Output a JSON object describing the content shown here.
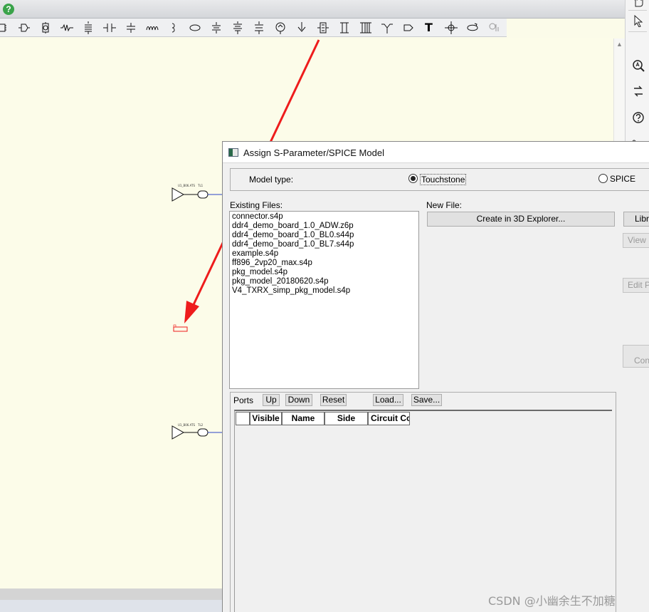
{
  "dialog": {
    "title": "Assign S-Parameter/SPICE Model",
    "model_type_label": "Model type:",
    "touchstone_label": "Touchstone",
    "spice_label": "SPICE",
    "existing_files_label": "Existing Files:",
    "new_file_label": "New File:",
    "files": [
      "connector.s4p",
      "ddr4_demo_board_1.0_ADW.z6p",
      "ddr4_demo_board_1.0_BL0.s44p",
      "ddr4_demo_board_1.0_BL7.s44p",
      "example.s4p",
      "ff896_2vp20_max.s4p",
      "pkg_model.s4p",
      "pkg_model_20180620.s4p",
      "V4_TXRX_simp_pkg_model.s4p"
    ],
    "create_3d_label": "Create in 3D Explorer...",
    "library_label": "Libra",
    "view_label": "View N",
    "edit_label": "Edit Pa",
    "conn_label": "Conn",
    "ports_label": "Ports",
    "up_label": "Up",
    "down_label": "Down",
    "reset_label": "Reset",
    "load_label": "Load...",
    "save_label": "Save...",
    "grid_columns": [
      "Visible",
      "Name",
      "Side",
      "Circuit Co"
    ]
  },
  "schematic": {
    "block1": {
      "driver_label": "U1_B06.ATS",
      "tline_label": "TL1"
    },
    "block2": {
      "driver_label": "U1_B06.ATS",
      "tline_label": "TL2"
    }
  },
  "watermark": "CSDN @小幽余生不加糖",
  "colors": {
    "annotation_arrow": "#ee1c1c",
    "canvas": "#fcfce9",
    "accent_help": "#3aa34a"
  },
  "toolbar_icons": [
    "component-icon",
    "ic-icon",
    "package-icon",
    "resistor-icon",
    "inductor-icon",
    "capacitor-icon",
    "small-cap-icon",
    "coil-icon",
    "bracket-icon",
    "ellipse-icon",
    "source-icon",
    "ground-icon",
    "diode-icon",
    "probe-icon",
    "arrow-down-icon",
    "transistor-icon",
    "connector-icon",
    "multi-connector-icon",
    "splitter-icon",
    "tag-icon",
    "text-tool-icon",
    "crosshair-icon",
    "loop-icon",
    "misc-tool-icon"
  ]
}
